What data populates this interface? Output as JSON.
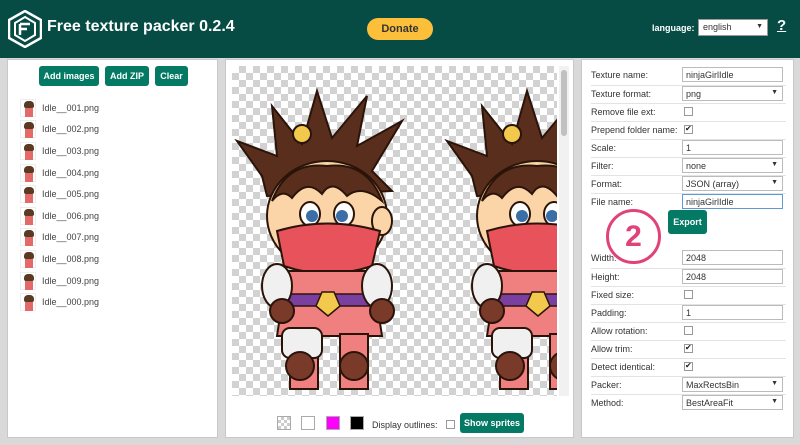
{
  "header": {
    "title": "Free texture packer 0.2.4",
    "donate_label": "Donate",
    "language_label": "language:",
    "language_value": "english",
    "help_label": "?"
  },
  "left_panel": {
    "add_images_label": "Add images",
    "add_zip_label": "Add ZIP",
    "clear_label": "Clear",
    "files": [
      "Idle__001.png",
      "Idle__002.png",
      "Idle__003.png",
      "Idle__004.png",
      "Idle__005.png",
      "Idle__006.png",
      "Idle__007.png",
      "Idle__008.png",
      "Idle__009.png",
      "Idle__000.png"
    ]
  },
  "center_panel": {
    "display_outlines_label": "Display outlines:",
    "show_sprites_label": "Show sprites",
    "swatch_colors": [
      "#ffffff",
      "#ff00ff",
      "#000000"
    ]
  },
  "settings": {
    "texture_name_label": "Texture name:",
    "texture_name_value": "ninjaGirlIdle",
    "texture_format_label": "Texture format:",
    "texture_format_value": "png",
    "remove_file_ext_label": "Remove file ext:",
    "prepend_folder_label": "Prepend folder name:",
    "scale_label": "Scale:",
    "scale_value": "1",
    "filter_label": "Filter:",
    "filter_value": "none",
    "format_label": "Format:",
    "format_value": "JSON (array)",
    "file_name_label": "File name:",
    "file_name_value": "ninjaGirlIdle",
    "export_label": "Export",
    "width_label": "Width:",
    "width_value": "2048",
    "height_label": "Height:",
    "height_value": "2048",
    "fixed_size_label": "Fixed size:",
    "padding_label": "Padding:",
    "padding_value": "1",
    "allow_rotation_label": "Allow rotation:",
    "allow_trim_label": "Allow trim:",
    "detect_identical_label": "Detect identical:",
    "packer_label": "Packer:",
    "packer_value": "MaxRectsBin",
    "method_label": "Method:",
    "method_value": "BestAreaFit"
  },
  "annotation": {
    "step_number": "2"
  },
  "colors": {
    "header_bg": "#064b44",
    "accent": "#047a65",
    "donate": "#fcbf3a",
    "annotation": "#e0437a"
  }
}
